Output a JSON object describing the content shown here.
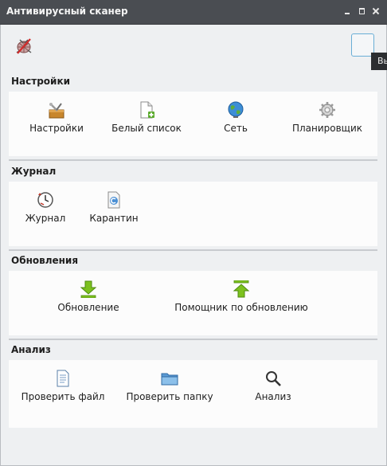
{
  "window": {
    "title": "Антивирусный сканер"
  },
  "toolbar": {
    "tooltip_text": "Вы"
  },
  "sections": {
    "settings": {
      "title": "Настройки",
      "items": [
        "Настройки",
        "Белый список",
        "Сеть",
        "Планировщик"
      ]
    },
    "journal": {
      "title": "Журнал",
      "items": [
        "Журнал",
        "Карантин"
      ]
    },
    "updates": {
      "title": "Обновления",
      "items": [
        "Обновление",
        "Помощник по обновлению"
      ]
    },
    "analysis": {
      "title": "Анализ",
      "items": [
        "Проверить файл",
        "Проверить папку",
        "Анализ"
      ]
    }
  },
  "colors": {
    "titlebar": "#4a4d52",
    "accent_blue": "#6aaed6",
    "update_green": "#7cc11e"
  },
  "icons": {
    "app": "antivirus-scanner-icon",
    "settings": "tools-box-icon",
    "whitelist": "document-add-icon",
    "network": "globe-icon",
    "scheduler": "gear-icon",
    "journal": "clock-log-icon",
    "quarantine": "quarantine-document-icon",
    "update": "download-arrow-icon",
    "update_helper": "upload-arrow-icon",
    "check_file": "text-file-icon",
    "check_folder": "folder-icon",
    "analysis": "magnifier-icon"
  }
}
